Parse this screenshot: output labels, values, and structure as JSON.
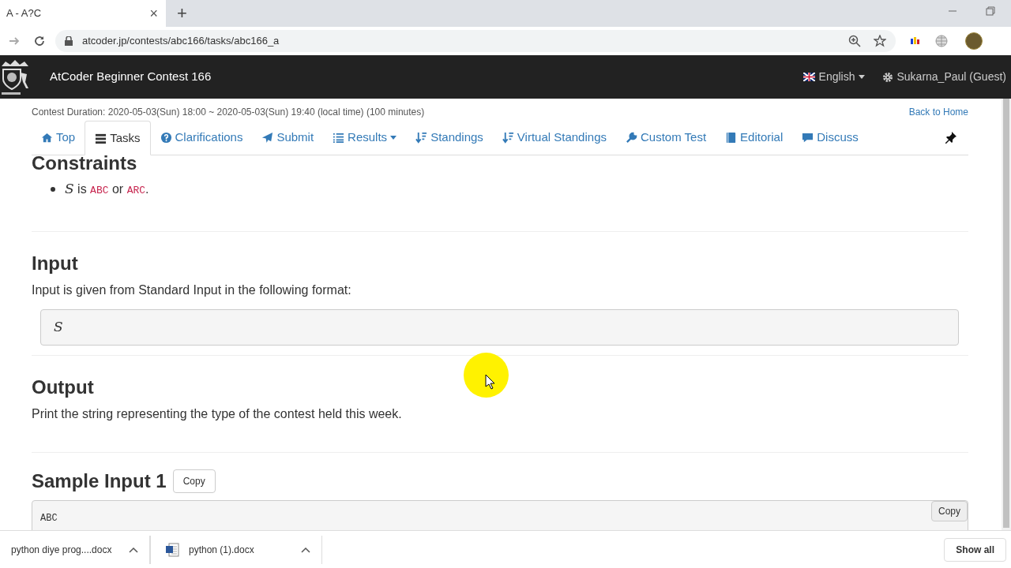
{
  "browser": {
    "tab_title": "A - A?C",
    "tab_close": "×",
    "new_tab": "+",
    "url": "atcoder.jp/contests/abc166/tasks/abc166_a"
  },
  "navbar": {
    "title": "AtCoder Beginner Contest 166",
    "language": "English",
    "user": "Sukarna_Paul (Guest)"
  },
  "contest_duration": "Contest Duration: 2020-05-03(Sun) 18:00 ~ 2020-05-03(Sun) 19:40 (local time) (100 minutes)",
  "back_link": "Back to Home",
  "nav_tabs": [
    {
      "label": "Top",
      "selected": false,
      "dropdown": false
    },
    {
      "label": "Tasks",
      "selected": true,
      "dropdown": false
    },
    {
      "label": "Clarifications",
      "selected": false,
      "dropdown": false
    },
    {
      "label": "Submit",
      "selected": false,
      "dropdown": false
    },
    {
      "label": "Results",
      "selected": false,
      "dropdown": true
    },
    {
      "label": "Standings",
      "selected": false,
      "dropdown": false
    },
    {
      "label": "Virtual Standings",
      "selected": false,
      "dropdown": false
    },
    {
      "label": "Custom Test",
      "selected": false,
      "dropdown": false
    },
    {
      "label": "Editorial",
      "selected": false,
      "dropdown": false
    },
    {
      "label": "Discuss",
      "selected": false,
      "dropdown": false
    }
  ],
  "sections": [
    {
      "kind": "constraints",
      "heading": "Constraints",
      "items": [
        {
          "var": "S",
          "parts": [
            "is",
            "ABC",
            "or",
            "ARC",
            "."
          ]
        }
      ]
    },
    {
      "kind": "text",
      "heading": "Input",
      "text": "Input is given from Standard Input in the following format:",
      "pre": "S"
    },
    {
      "kind": "text",
      "heading": "Output",
      "text": "Print the string representing the type of the contest held this week."
    },
    {
      "kind": "sample",
      "heading": "Sample Input 1",
      "copy": "Copy",
      "pre": "ABC",
      "copy2": "Copy"
    }
  ],
  "downloads": {
    "items": [
      {
        "name": "python diye prog....docx",
        "kind": "plain"
      },
      {
        "name": "python (1).docx",
        "kind": "word"
      }
    ],
    "show_all": "Show all"
  }
}
